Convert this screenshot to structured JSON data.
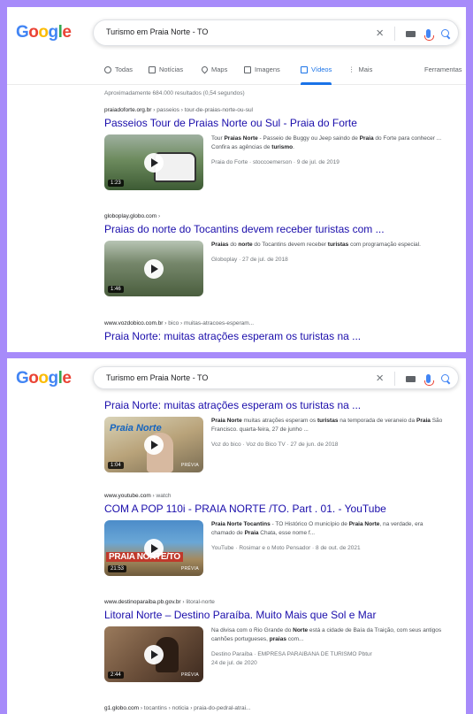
{
  "brand": {
    "logo_letters": [
      {
        "ch": "G",
        "color": "#4285f4"
      },
      {
        "ch": "o",
        "color": "#ea4335"
      },
      {
        "ch": "o",
        "color": "#fbbc05"
      },
      {
        "ch": "g",
        "color": "#4285f4"
      },
      {
        "ch": "l",
        "color": "#34a853"
      },
      {
        "ch": "e",
        "color": "#ea4335"
      }
    ],
    "link_color": "#1a0dab",
    "accent": "#1a73e8"
  },
  "search": {
    "query_panel1": "Turismo em Praia Norte - TO",
    "query_panel2": "Turismo em Praia Norte - TO"
  },
  "tabs": [
    {
      "label": "Todas",
      "icon": "search-icon"
    },
    {
      "label": "Notícias",
      "icon": "news-icon"
    },
    {
      "label": "Maps",
      "icon": "map-pin-icon"
    },
    {
      "label": "Imagens",
      "icon": "image-icon"
    },
    {
      "label": "Vídeos",
      "icon": "video-icon",
      "active": true
    },
    {
      "label": "Mais",
      "icon": "more-icon"
    },
    {
      "label": "Ferramentas",
      "icon": ""
    }
  ],
  "stats": "Aproximadamente 684.000 resultados (0,54 segundos)",
  "results": [
    {
      "crumb": "praiadoforte.org.br",
      "crumb_path": " › passeios › tour-de-praias-norte-ou-sul",
      "title": "Passeios Tour de Praias Norte ou Sul - Praia do Forte",
      "snippet": "Tour <b>Praias Norte</b> - Passeio de Buggy ou Jeep saindo de <b>Praia</b> do Forte para conhecer ... Confira as agências de <b>turismo</b>.",
      "meta": "Praia do Forte · stoccoemerson · 9 de jul. de 2019",
      "duration": "1:23"
    },
    {
      "crumb": "globoplay.globo.com",
      "crumb_path": " ›",
      "title": "Praias do norte do Tocantins devem receber turistas com ...",
      "snippet": "<b>Praias</b> do <b>norte</b> do Tocantins devem receber <b>turistas</b> com programação especial.",
      "meta": "Globoplay · 27 de jul. de 2018",
      "duration": "1:46"
    },
    {
      "crumb": "www.vozdobico.com.br",
      "crumb_path": " › bico › muitas-atracoes-esperam...",
      "title": "Praia Norte: muitas atrações esperam os turistas na ..."
    }
  ],
  "results2": [
    {
      "title": "Praia Norte: muitas atrações esperam os turistas na ...",
      "snippet": "<b>Praia Norte</b> muitas atrações esperam os <b>turistas</b> na temporada de veraneio da <b>Praia</b> São Francisco. quarta-feira, 27 de junho ...",
      "meta": "Voz do bico · Voz do Bico TV · 27 de jun. de 2018",
      "duration": "1:04",
      "preview": "PRÉVIA",
      "thumb_logo": "Praia Norte"
    },
    {
      "crumb": "www.youtube.com",
      "crumb_path": " › watch",
      "title": "COM A POP 110i - PRAIA NORTE /TO. Part . 01. - YouTube",
      "snippet": "<b>Praia Norte Tocantins</b> - TO Histórico O município de <b>Praia Norte</b>, na verdade, era chamado de <b>Praia</b> Chata, esse nome f...",
      "meta": "YouTube · Rosimar e o Moto Pensador · 8 de out. de 2021",
      "duration": "21:53",
      "preview": "PRÉVIA",
      "thumb_banner": "PRAIA NORTE/TO"
    },
    {
      "crumb": "www.destinoparaiba.pb.gov.br",
      "crumb_path": " › litoral-norte",
      "title": "Litoral Norte – Destino Paraíba. Muito Mais que Sol e Mar",
      "snippet": "Na divisa com o Rio Grande do <b>Norte</b> está a cidade de Baía da Traição, com seus antigos canhões portugueses, <b>praias</b> com...",
      "meta": "Destino Paraíba · EMPRESA PARAIBANA DE TURISMO Pbtur",
      "meta2": "24 de jul. de 2020",
      "duration": "2:44",
      "preview": "PRÉVIA"
    },
    {
      "crumb": "g1.globo.com",
      "crumb_path": " › tocantins › noticia › praia-do-pedral-atrai..."
    }
  ]
}
